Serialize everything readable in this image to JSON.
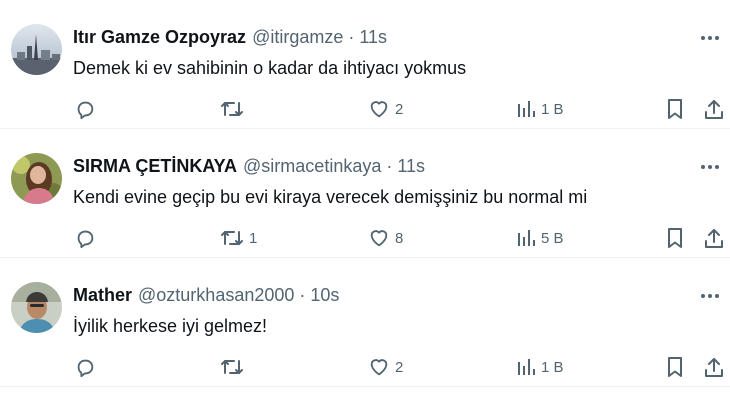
{
  "tweets": [
    {
      "name": "Itır Gamze Ozpoyraz",
      "handle": "@itirgamze",
      "separator": "·",
      "time": "11s",
      "text": "Demek ki ev sahibinin o kadar da ihtiyacı yokmus",
      "reply_count": "",
      "retweet_count": "",
      "like_count": "2",
      "view_count": "1 B"
    },
    {
      "name": "SIRMA ÇETİNKAYA",
      "handle": "@sirmacetinkaya",
      "separator": "·",
      "time": "11s",
      "text": "Kendi evine geçip bu evi kiraya verecek demişşiniz bu normal mi",
      "reply_count": "",
      "retweet_count": "1",
      "like_count": "8",
      "view_count": "5 B"
    },
    {
      "name": "Mather",
      "handle": "@ozturkhasan2000",
      "separator": "·",
      "time": "10s",
      "text": "İyilik herkese iyi gelmez!",
      "reply_count": "",
      "retweet_count": "",
      "like_count": "2",
      "view_count": "1 B"
    }
  ],
  "colors": {
    "text_primary": "#0f1419",
    "text_secondary": "#536471",
    "divider": "#eff3f4"
  },
  "icons": [
    "reply-icon",
    "retweet-icon",
    "like-icon",
    "views-icon",
    "bookmark-icon",
    "share-icon",
    "more-icon"
  ]
}
